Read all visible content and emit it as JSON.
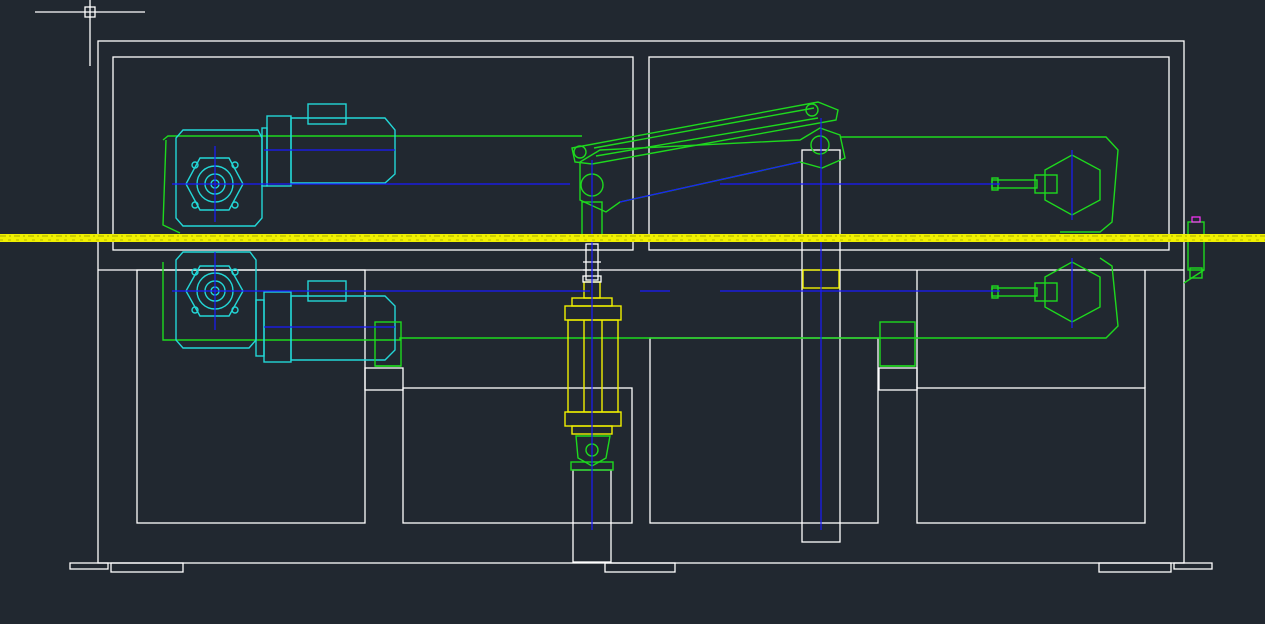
{
  "drawing": {
    "background": "#212830",
    "layer_colors": {
      "frame": "#ffffff",
      "clamp_arms": "#1ed91e",
      "motors": "#23d7d7",
      "cylinder": "#f0f000",
      "centerlines": "#1a1aff",
      "marker": "#ff33ff"
    }
  }
}
